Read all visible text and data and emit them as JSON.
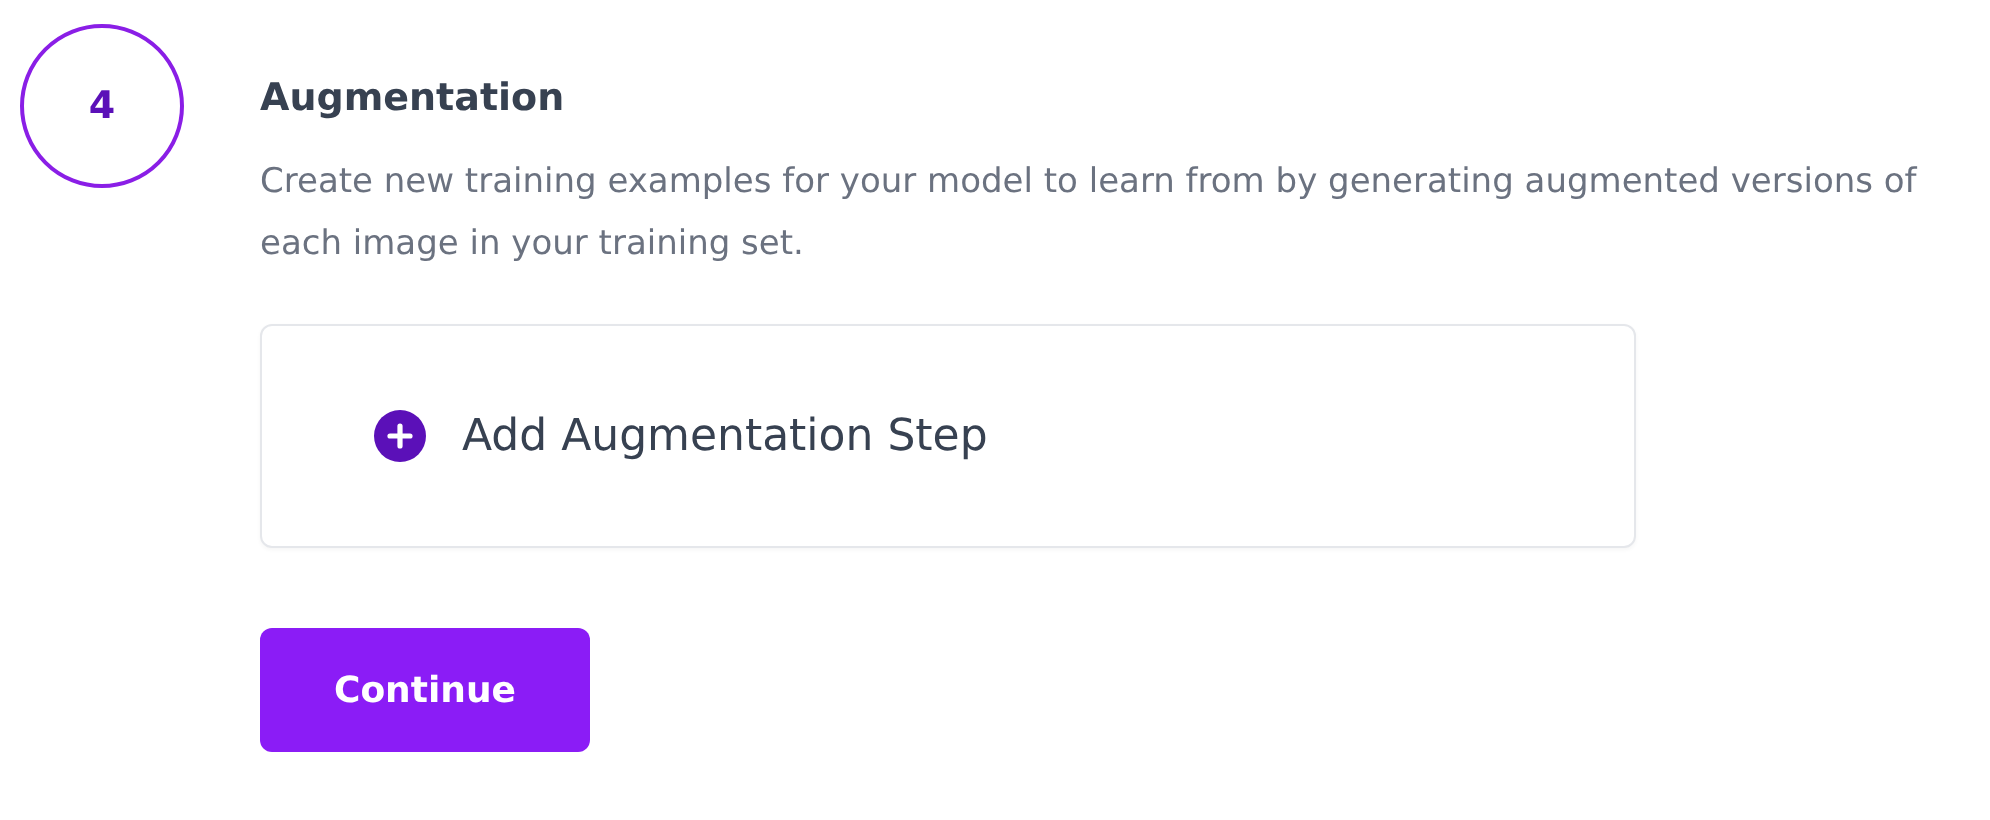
{
  "step": {
    "number": "4",
    "title": "Augmentation",
    "description": "Create new training examples for your model to learn from by generating augmented versions of each image in your training set."
  },
  "add_step": {
    "label": "Add Augmentation Step"
  },
  "continue_button": {
    "label": "Continue"
  }
}
